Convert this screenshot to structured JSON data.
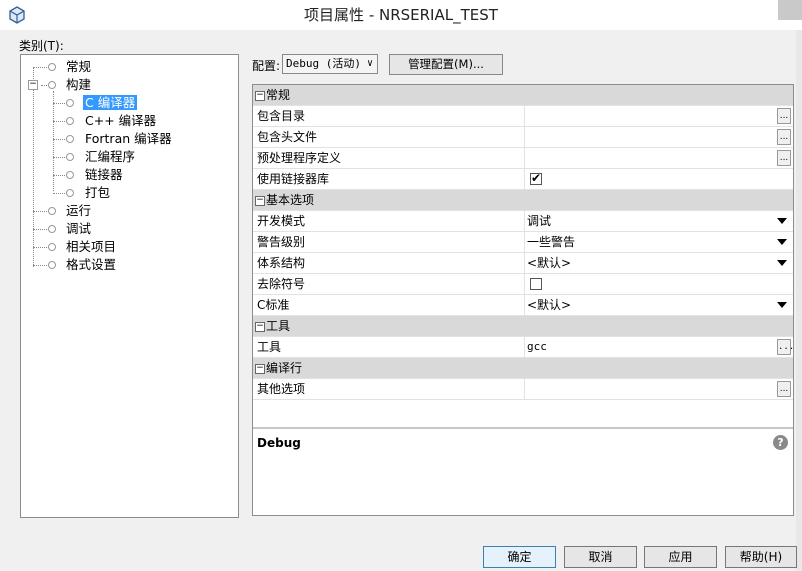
{
  "window": {
    "title": "项目属性 - NRSERIAL_TEST"
  },
  "category_label": "类别(T):",
  "tree": {
    "general": "常规",
    "build": "构建",
    "c_compiler": "C 编译器",
    "cpp_compiler": "C++ 编译器",
    "fortran_compiler": "Fortran 编译器",
    "assembler": "汇编程序",
    "linker": "链接器",
    "packaging": "打包",
    "run": "运行",
    "debug": "调试",
    "related": "相关项目",
    "format": "格式设置"
  },
  "config": {
    "label": "配置:",
    "selected": "Debug (活动)",
    "manage_label": "管理配置(M)..."
  },
  "properties": {
    "sec_general": "常规",
    "include_dirs": "包含目录",
    "include_headers": "包含头文件",
    "preprocessor_defs": "预处理程序定义",
    "use_linker_libs": "使用链接器库",
    "sec_basic": "基本选项",
    "dev_mode": "开发模式",
    "dev_mode_val": "调试",
    "warning_level": "警告级别",
    "warning_level_val": "一些警告",
    "architecture": "体系结构",
    "architecture_val": "<默认>",
    "strip_symbols": "去除符号",
    "c_standard": "C标准",
    "c_standard_val": "<默认>",
    "sec_tools": "工具",
    "tool": "工具",
    "tool_val": "gcc",
    "sec_cmdline": "编译行",
    "other_options": "其他选项"
  },
  "description": {
    "title": "Debug"
  },
  "buttons": {
    "ok": "确定",
    "cancel": "取消",
    "apply": "应用",
    "help": "帮助(H)"
  },
  "colors": {
    "selection": "#3399ff",
    "section_bg": "#d9d9d9"
  }
}
